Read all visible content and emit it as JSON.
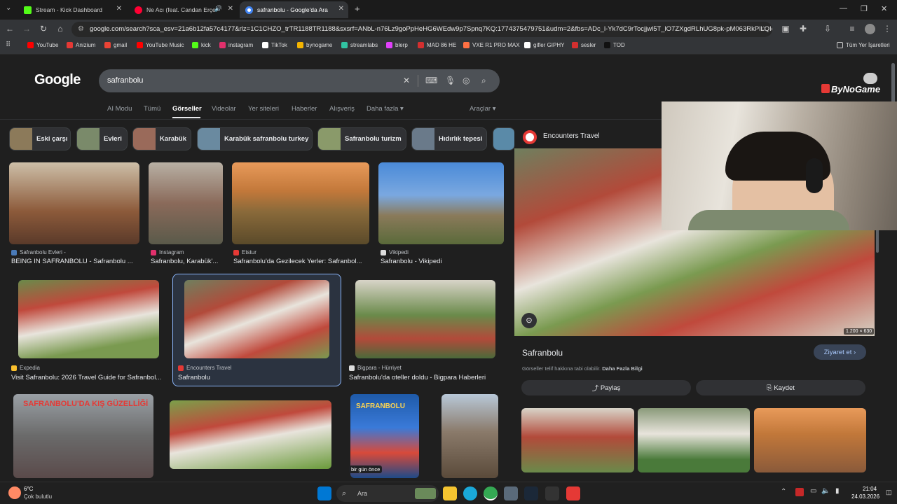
{
  "tabs": [
    {
      "title": "Stream - Kick Dashboard",
      "color": "#53fc18"
    },
    {
      "title": "Ne Acı (feat. Candan Erçetin)",
      "color": "#ff0033"
    },
    {
      "title": "safranbolu - Google'da Ara",
      "color": "#4285f4"
    }
  ],
  "address": "google.com/search?sca_esv=21a6b12fa57c4177&rlz=1C1CHZO_trTR1188TR1188&sxsrf=ANbL-n76Lz9goPpHeHG6WEdw9p7Spnq7KQ:1774375479751&udm=2&fbs=ADc_l-Yk7dC9rTocjjwl5T_lO7ZXgdRLhUG8pk-pM063RkPlLQIo...",
  "bookmarks": [
    {
      "label": "YouTube",
      "color": "#ff0000"
    },
    {
      "label": "Anizium",
      "color": "#e53935"
    },
    {
      "label": "gmail",
      "color": "#ea4335"
    },
    {
      "label": "YouTube Music",
      "color": "#ff0000"
    },
    {
      "label": "kick",
      "color": "#53fc18"
    },
    {
      "label": "instagram",
      "color": "#e1306c"
    },
    {
      "label": "TikTok",
      "color": "#ffffff"
    },
    {
      "label": "bynogame",
      "color": "#f4b400"
    },
    {
      "label": "streamlabs",
      "color": "#31c3a2"
    },
    {
      "label": "blerp",
      "color": "#e040fb"
    },
    {
      "label": "MAD 86 HE",
      "color": "#d32f2f"
    },
    {
      "label": "VXE R1 PRO MAX",
      "color": "#ff7043"
    },
    {
      "label": "gifler GIPHY",
      "color": "#ffffff"
    },
    {
      "label": "sesler",
      "color": "#d32f2f"
    },
    {
      "label": "TOD",
      "color": "#111111"
    }
  ],
  "all_bookmarks": "Tüm Yer İşaretleri",
  "search": {
    "logo": "Google",
    "query": "safranbolu"
  },
  "filters": [
    "AI Modu",
    "Tümü",
    "Görseller",
    "Videolar",
    "Yer siteleri",
    "Haberler",
    "Alışveriş",
    "Daha fazla"
  ],
  "tools": "Araçlar",
  "chips": [
    "Eski çarşı",
    "Evleri",
    "Karabük",
    "Karabük safranbolu turkey",
    "Safranbolu turizm",
    "Hıdırlık tepesi"
  ],
  "results": [
    {
      "source": "Safranbolu Evleri -",
      "title": "BEING IN SAFRANBOLU - Safranbolu ...",
      "color": "#a05a3a"
    },
    {
      "source": "Instagram",
      "title": "Safranbolu, Karabük'...",
      "color": "#8a6a5a"
    },
    {
      "source": "Etstur",
      "title": "Safranbolu'da Gezilecek Yerler: Safranbol...",
      "color": "#c2783a"
    },
    {
      "source": "Vikipedi",
      "title": "Safranbolu - Vikipedi",
      "color": "#4a76b8"
    },
    {
      "source": "Expedia",
      "title": "Visit Safranbolu: 2026 Travel Guide for Safranbol...",
      "color": "#b24a3a"
    },
    {
      "source": "Encounters Travel",
      "title": "Safranbolu",
      "color": "#a8453a"
    },
    {
      "source": "Bigpara - Hürriyet",
      "title": "Safranbolu'da oteller doldu - Bigpara Haberleri",
      "color": "#6a8a4a"
    }
  ],
  "row3": [
    {
      "overlay": "SAFRANBOLU'DA KIŞ GÜZELLİĞİ",
      "color": "#6a6a6a"
    },
    {
      "overlay": "",
      "color": "#7aa04a"
    },
    {
      "overlay": "SAFRANBOLU",
      "tag": "bir gün önce",
      "color": "#1e5aa8"
    },
    {
      "overlay": "",
      "color": "#8a7a6a"
    }
  ],
  "panel": {
    "source": "Encounters Travel",
    "image_size": "1.200 × 630",
    "title": "Safranbolu",
    "visit": "Ziyaret et",
    "copyright": "Görseller telif hakkına tabi olabilir.",
    "more_info": "Daha Fazla Bilgi",
    "share": "Paylaş",
    "save": "Kaydet"
  },
  "overlay_brand": "ByNoGame",
  "taskbar": {
    "temp": "6°C",
    "weather": "Çok bulutlu",
    "search": "Ara",
    "time": "21:04",
    "date": "24.03.2026"
  }
}
